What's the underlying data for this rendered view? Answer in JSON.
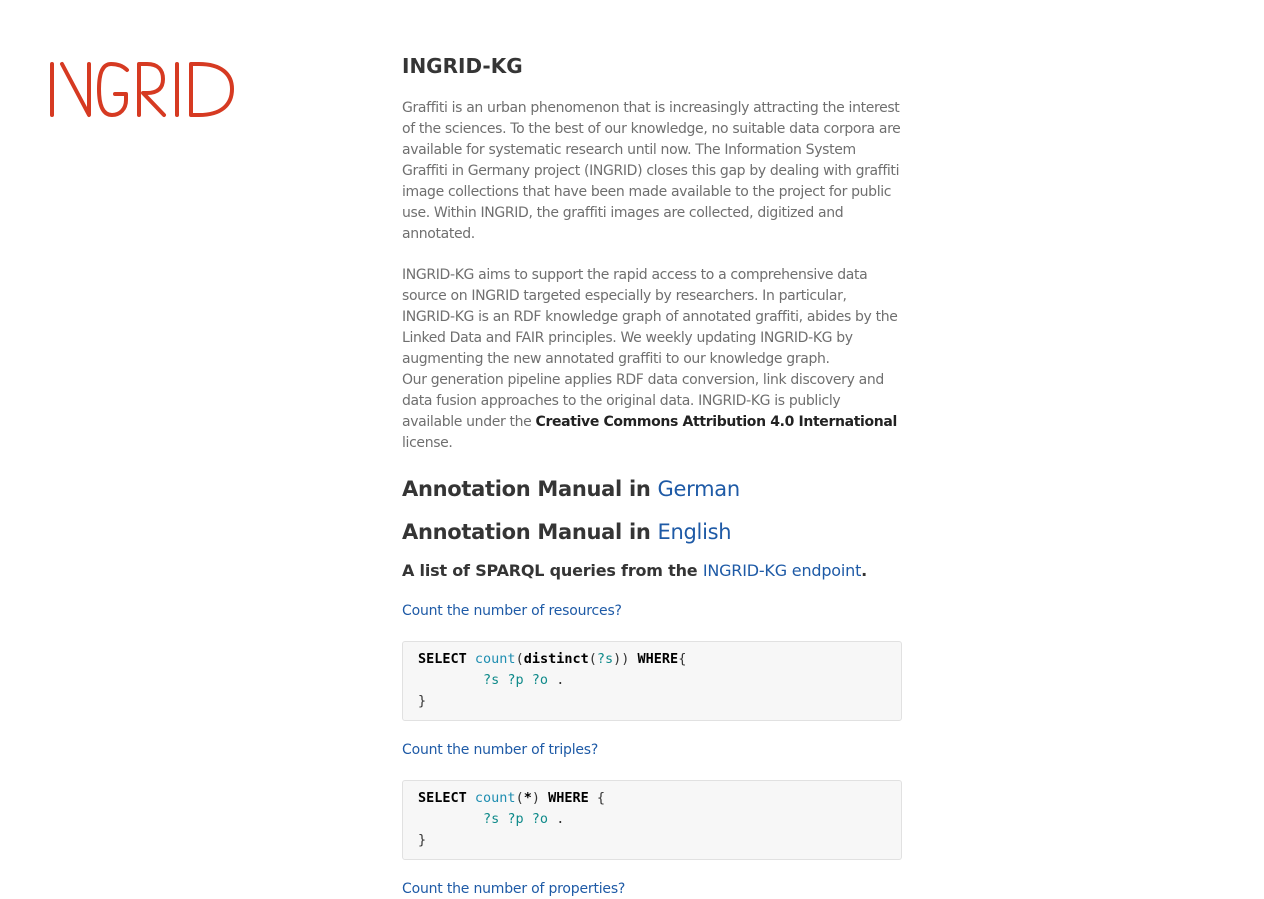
{
  "logo": {
    "text": "INGRID",
    "color": "#d63a22"
  },
  "title": "INGRID-KG",
  "para1": "Graffiti is an urban phenomenon that is increasingly attracting the interest of the sciences. To the best of our knowledge, no suitable data corpora are available for systematic research until now. The Information System Graffiti in Germany project (INGRID) closes this gap by dealing with graffiti image collections that have been made available to the project for public use. Within INGRID, the graffiti images are collected, digitized and annotated.",
  "para2": {
    "text1": "INGRID-KG aims to support the rapid access to a comprehensive data source on INGRID targeted especially by researchers. In particular, INGRID-KG is an RDF knowledge graph of annotated graffiti, abides by the Linked Data and FAIR principles. We weekly updating INGRID-KG by augmenting the new annotated graffiti to our knowledge graph.",
    "text2": "Our generation pipeline applies RDF data conversion, link discovery and data fusion approaches to the original data. INGRID-KG is publicly available under the ",
    "license": "Creative Commons Attribution 4.0 International",
    "suffix": " license."
  },
  "manual_german": {
    "prefix": "Annotation Manual in ",
    "link": "German"
  },
  "manual_english": {
    "prefix": "Annotation Manual in ",
    "link": "English"
  },
  "sparql_heading": {
    "prefix": "A list of SPARQL queries from the ",
    "link": "INGRID-KG endpoint",
    "suffix": "."
  },
  "queries": [
    {
      "question": "Count the number of resources?",
      "code": {
        "select": "SELECT",
        "fn": "count",
        "open1": "(",
        "distinct": "distinct",
        "open2": "(",
        "var": "?s",
        "close": "))",
        "where": "WHERE",
        "brace": "{",
        "pattern": "?s ?p ?o",
        "dot": " .",
        "end": "}"
      }
    },
    {
      "question": "Count the number of triples?",
      "code": {
        "select": "SELECT",
        "fn": "count",
        "open1": "(",
        "star": "*",
        "close": ")",
        "where": "WHERE",
        "brace": " {",
        "pattern": "?s ?p ?o",
        "dot": " .",
        "end": "}"
      }
    },
    {
      "question": "Count the number of properties?"
    }
  ],
  "colors": {
    "link": "#1e5aa6",
    "heading": "#353535",
    "body": "#6f6f6f",
    "code_bg": "#f7f7f7"
  }
}
